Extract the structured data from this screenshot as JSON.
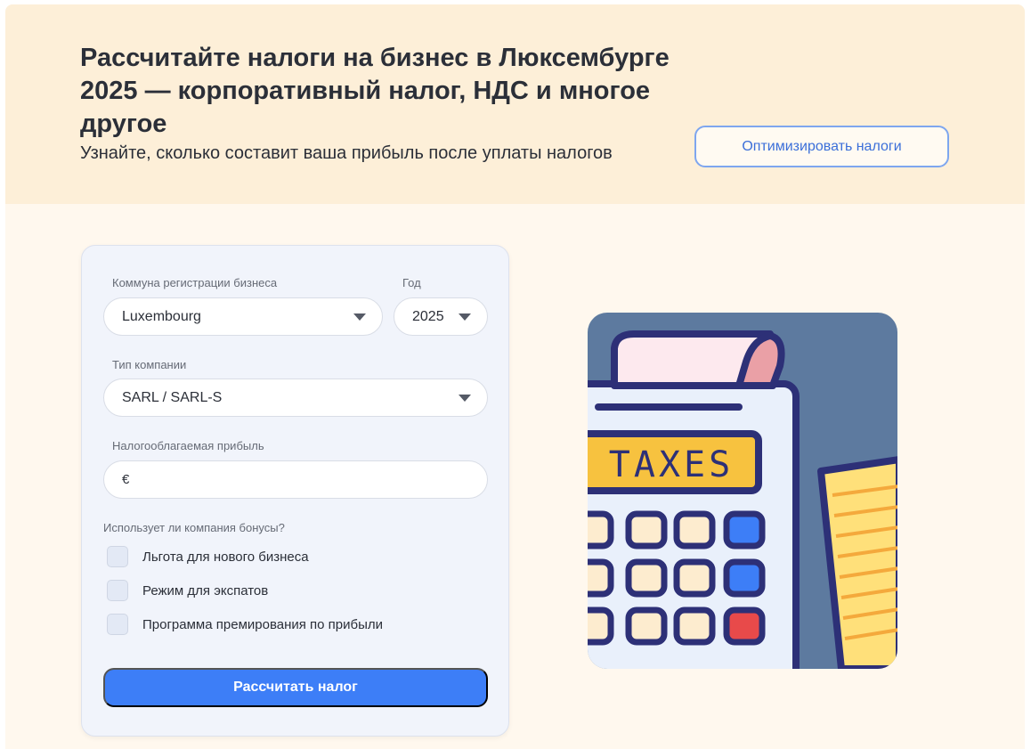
{
  "hero": {
    "title": "Рассчитайте налоги на бизнес в Люксембурге 2025 — корпоративный налог, НДС и многое другое",
    "subtitle": "Узнайте, сколько составит ваша прибыль после уплаты налогов",
    "optimize_button": "Оптимизировать налоги"
  },
  "form": {
    "commune_label": "Коммуна регистрации бизнеса",
    "commune_value": "Luxembourg",
    "year_label": "Год",
    "year_value": "2025",
    "company_type_label": "Тип компании",
    "company_type_value": "SARL / SARL-S",
    "profit_label": "Налогооблагаемая прибыль",
    "profit_currency": "€",
    "profit_value": "",
    "bonus_question": "Использует ли компания бонусы?",
    "bonuses": [
      {
        "label": "Льгота для нового бизнеса",
        "checked": false
      },
      {
        "label": "Режим для экспатов",
        "checked": false
      },
      {
        "label": "Программа премирования по прибыли",
        "checked": false
      }
    ],
    "calculate_button": "Рассчитать налог"
  },
  "illustration": {
    "display_text": "TAXES",
    "icon": "calculator-taxes-icon",
    "colors": {
      "background": "#5d7a9f",
      "display": "#f7c23f",
      "outline": "#2d3077",
      "key_blue": "#3d7ef7",
      "key_red": "#e84a4a",
      "paper": "#f7c6cb",
      "notepad": "#ffe07a"
    }
  },
  "colors": {
    "hero_bg": "#fdefd8",
    "main_bg": "#fff8ee",
    "accent": "#3d7ef7",
    "card_bg": "#f1f4fb"
  }
}
